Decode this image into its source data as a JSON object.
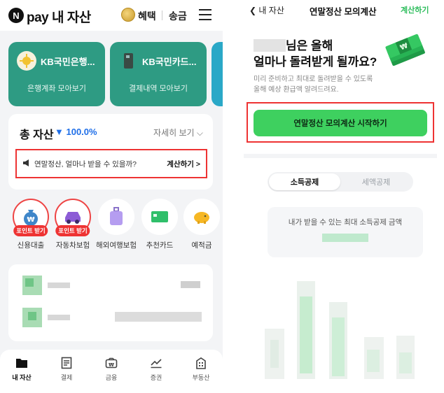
{
  "left": {
    "header": {
      "logo_mark": "N",
      "logo_text": "pay 내 자산",
      "benefit": "혜택",
      "transfer": "송금"
    },
    "cards": [
      {
        "title": "KB국민은행...",
        "subtitle": "은행계좌 모아보기"
      },
      {
        "title": "KB국민카드...",
        "subtitle": "결제내역 모아보기"
      }
    ],
    "assets": {
      "title": "총 자산",
      "change": "▼ 100.0%",
      "detail": "자세히 보기 ⌵"
    },
    "banner": {
      "text": "연말정산, 얼마나 받을 수 있을까?",
      "action": "계산하기 >"
    },
    "quick": [
      {
        "label": "신용대출",
        "badge": "포인트 받기",
        "icon": "moneybag-icon"
      },
      {
        "label": "자동차보험",
        "badge": "포인트 받기",
        "icon": "car-icon"
      },
      {
        "label": "해외여행보험",
        "badge": "",
        "icon": "suitcase-icon"
      },
      {
        "label": "추천카드",
        "badge": "",
        "icon": "card-icon"
      },
      {
        "label": "예적금",
        "badge": "",
        "icon": "piggybank-icon"
      }
    ],
    "nav": [
      {
        "label": "내 자산",
        "icon": "folder-icon",
        "active": true
      },
      {
        "label": "결제",
        "icon": "receipt-icon",
        "active": false
      },
      {
        "label": "금융",
        "icon": "wallet-icon",
        "active": false
      },
      {
        "label": "증권",
        "icon": "chart-icon",
        "active": false
      },
      {
        "label": "부동산",
        "icon": "building-icon",
        "active": false
      }
    ]
  },
  "right": {
    "back": "내 자산",
    "title": "연말정산 모의계산",
    "calc": "계산하기",
    "headline_l1": "님은 올해",
    "headline_l2": "얼마나 돌려받게 될까요?",
    "desc_l1": "미리 준비하고 최대로 돌려받을 수 있도록",
    "desc_l2": "올해 예상 환급액 알려드려요.",
    "start_button": "연말정산 모의계산 시작하기",
    "tabs": [
      "소득공제",
      "세액공제"
    ],
    "max_label": "내가 받을 수 있는 최대 소득공제 금액"
  },
  "colors": {
    "accent_green": "#3ed05f",
    "card_teal": "#2e9b83",
    "highlight_red": "#e33333",
    "blue": "#1e6ee8"
  }
}
